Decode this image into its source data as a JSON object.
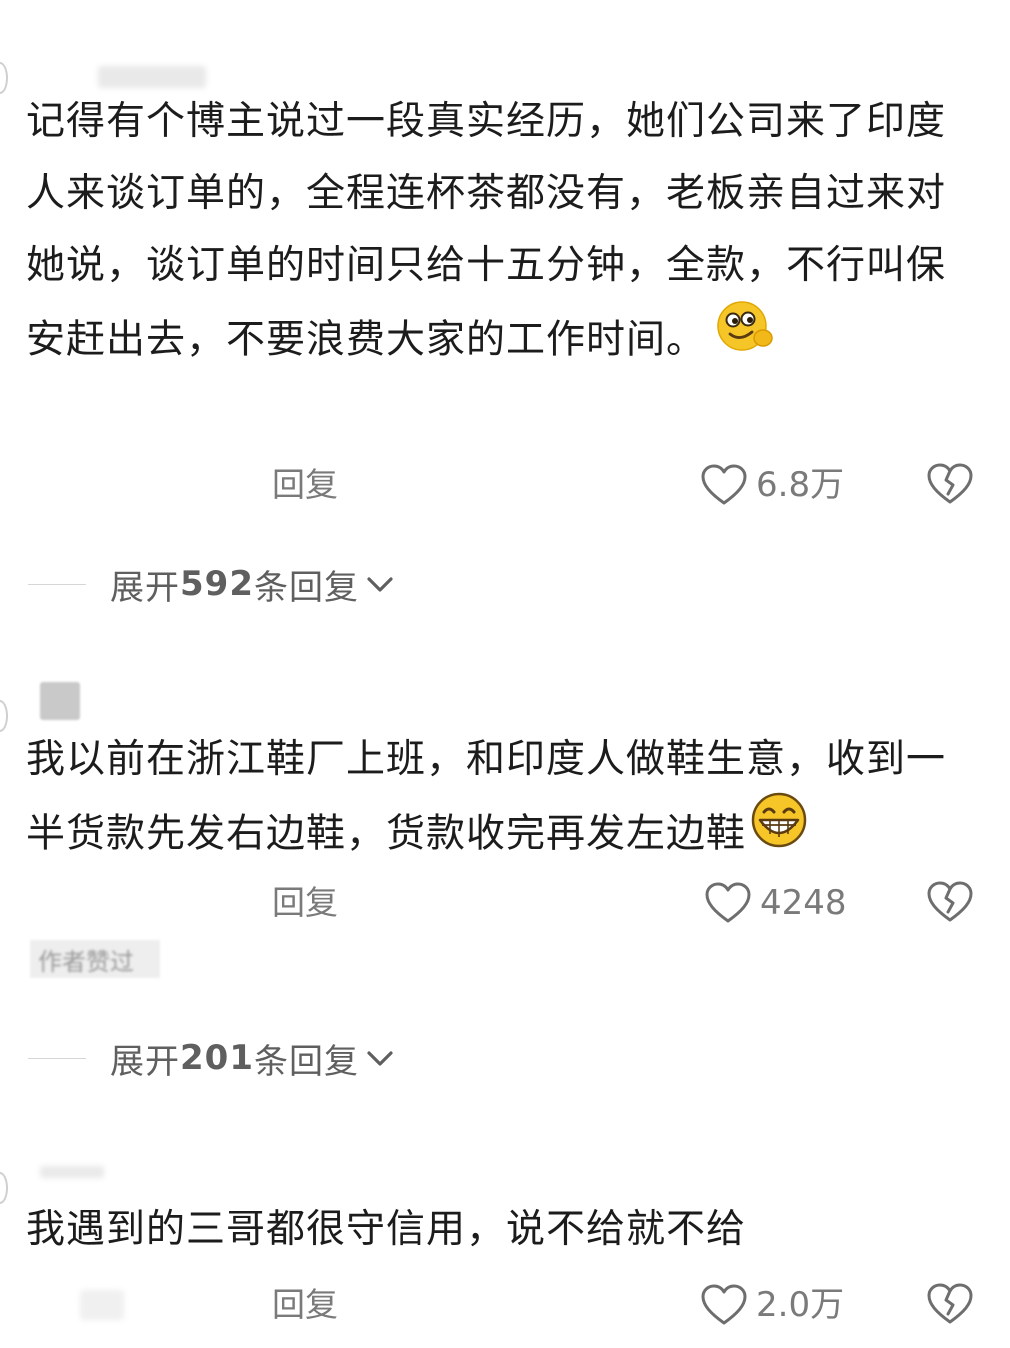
{
  "comments": [
    {
      "text": "记得有个博主说过一段真实经历，她们公司来了印度人来谈订单的，全程连杯茶都没有，老板亲自过来对她说，谈订单的时间只给十五分钟，全款，不行叫保安赶出去，不要浪费大家的工作时间。",
      "emoji_icon": "smirk-emoji",
      "reply_label": "回复",
      "like_count": "6.8万",
      "expand": {
        "prefix": "展开",
        "count": "592",
        "suffix": "条回复"
      }
    },
    {
      "text": "我以前在浙江鞋厂上班，和印度人做鞋生意，收到一半货款先发右边鞋，货款收完再发左边鞋",
      "emoji_icon": "grin-emoji",
      "reply_label": "回复",
      "like_count": "4248",
      "author_badge": "作者赞过",
      "expand": {
        "prefix": "展开",
        "count": "201",
        "suffix": "条回复"
      }
    },
    {
      "text": "我遇到的三哥都很守信用，说不给就不给",
      "reply_label": "回复",
      "like_count": "2.0万"
    }
  ],
  "colors": {
    "text": "#1c1c1c",
    "muted": "#7a7a7a",
    "expand": "#5f5f5f",
    "emoji": "#f6c629"
  }
}
